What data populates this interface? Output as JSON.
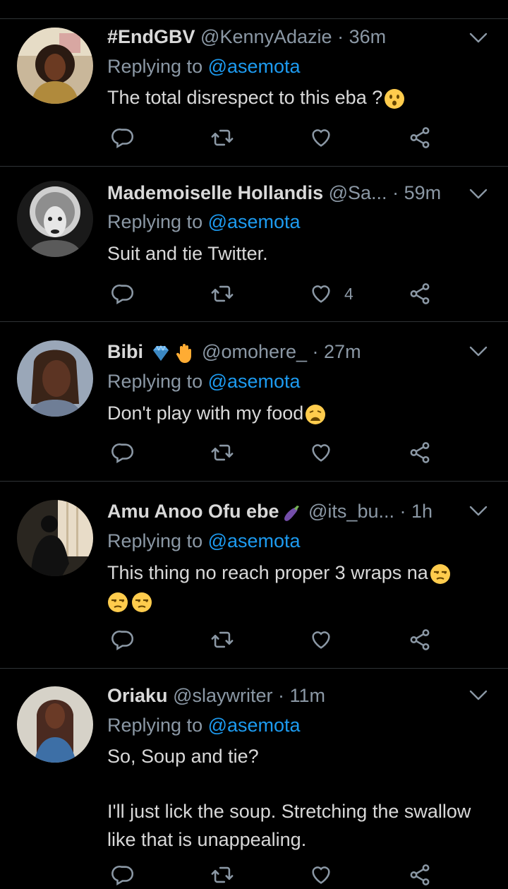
{
  "replies": [
    {
      "name": "#EndGBV",
      "handle": "@KennyAdazie",
      "time": "· 36m",
      "replying_prefix": "Replying to",
      "replying_to": "@asemota",
      "text": "The total disrespect to this eba ?",
      "text_emoji": "hushed-face",
      "likes": ""
    },
    {
      "name": "Mademoiselle Hollandis",
      "handle": "@Sa...",
      "time": "· 59m",
      "replying_prefix": "Replying to",
      "replying_to": "@asemota",
      "text": "Suit and tie Twitter.",
      "likes": "4"
    },
    {
      "name": "Bibi",
      "name_emojis": [
        "gem-stone",
        "raised-hand"
      ],
      "handle": "@omohere_",
      "time": "· 27m",
      "replying_prefix": "Replying to",
      "replying_to": "@asemota",
      "text": "Don't play with my food",
      "text_emoji": "weary-face",
      "likes": ""
    },
    {
      "name": "Amu Anoo Ofu ebe",
      "name_emojis": [
        "eggplant"
      ],
      "handle": "@its_bu...",
      "time": "· 1h",
      "replying_prefix": "Replying to",
      "replying_to": "@asemota",
      "text": "This thing no reach proper 3 wraps na",
      "text_emojis": [
        "unamused-face",
        "unamused-face",
        "unamused-face"
      ],
      "likes": ""
    },
    {
      "name": "Oriaku",
      "handle": "@slaywriter",
      "time": "· 11m",
      "replying_prefix": "Replying to",
      "replying_to": "@asemota",
      "text": "So, Soup and tie?",
      "text2": "I'll just lick the soup. Stretching the swallow like that is unappealing.",
      "likes": ""
    }
  ],
  "colors": {
    "background": "#000000",
    "text": "#d9d9d9",
    "secondary": "#8b98a5",
    "link": "#1d9bf0",
    "divider": "#2f3336"
  },
  "icons": [
    "reply-icon",
    "retweet-icon",
    "like-icon",
    "share-icon",
    "chevron-down-icon"
  ]
}
